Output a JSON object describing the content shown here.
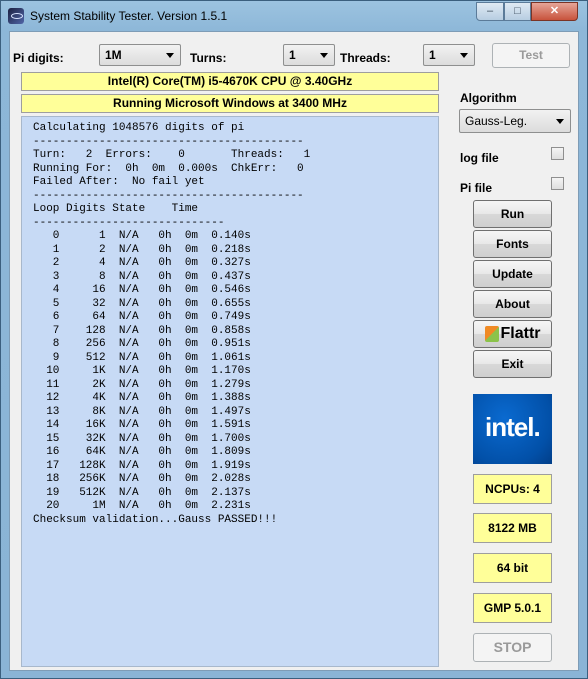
{
  "window": {
    "title": "System Stability Tester. Version 1.5.1",
    "min_glyph": "–",
    "max_glyph": "□",
    "close_glyph": "✕"
  },
  "controls": {
    "pi_digits_label": "Pi digits:",
    "pi_digits_value": "1M",
    "turns_label": "Turns:",
    "turns_value": "1",
    "threads_label": "Threads:",
    "threads_value": "1",
    "test_button": "Test"
  },
  "banners": {
    "cpu": "Intel(R) Core(TM) i5-4670K CPU @ 3.40GHz",
    "os": "Running Microsoft Windows at 3400 MHz"
  },
  "console": {
    "lines": [
      "Calculating 1048576 digits of pi",
      "-----------------------------------------",
      "Turn:   2  Errors:    0       Threads:   1",
      "Running For:  0h  0m  0.000s  ChkErr:   0",
      "Failed After:  No fail yet",
      "-----------------------------------------",
      "Loop Digits State    Time",
      "-----------------------------",
      "   0      1  N/A   0h  0m  0.140s",
      "   1      2  N/A   0h  0m  0.218s",
      "   2      4  N/A   0h  0m  0.327s",
      "   3      8  N/A   0h  0m  0.437s",
      "   4     16  N/A   0h  0m  0.546s",
      "   5     32  N/A   0h  0m  0.655s",
      "   6     64  N/A   0h  0m  0.749s",
      "   7    128  N/A   0h  0m  0.858s",
      "   8    256  N/A   0h  0m  0.951s",
      "   9    512  N/A   0h  0m  1.061s",
      "  10     1K  N/A   0h  0m  1.170s",
      "  11     2K  N/A   0h  0m  1.279s",
      "  12     4K  N/A   0h  0m  1.388s",
      "  13     8K  N/A   0h  0m  1.497s",
      "  14    16K  N/A   0h  0m  1.591s",
      "  15    32K  N/A   0h  0m  1.700s",
      "  16    64K  N/A   0h  0m  1.809s",
      "  17   128K  N/A   0h  0m  1.919s",
      "  18   256K  N/A   0h  0m  2.028s",
      "  19   512K  N/A   0h  0m  2.137s",
      "  20     1M  N/A   0h  0m  2.231s",
      "Checksum validation...Gauss PASSED!!!"
    ]
  },
  "side": {
    "algorithm_label": "Algorithm",
    "algorithm_value": "Gauss-Leg.",
    "log_file_label": "log file",
    "pi_file_label": "Pi file",
    "run": "Run",
    "fonts": "Fonts",
    "update": "Update",
    "about": "About",
    "flattr": "Flattr",
    "exit": "Exit",
    "intel_logo": "intel.",
    "ncpus": "NCPUs: 4",
    "memory": "8122 MB",
    "bits": "64 bit",
    "gmp": "GMP 5.0.1",
    "stop": "STOP"
  },
  "colors": {
    "highlight": "#ffff99",
    "console_bg": "#c7daf5",
    "intel_blue": "#0250a8"
  }
}
